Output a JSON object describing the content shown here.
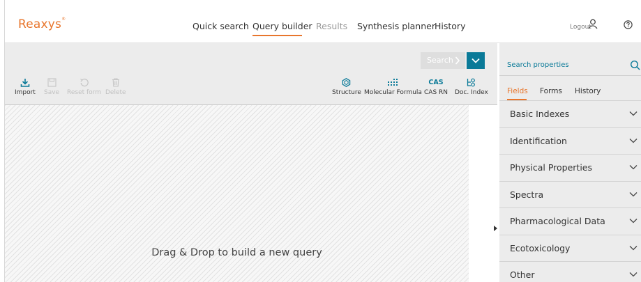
{
  "header": {
    "logo": "Reaxys",
    "logo_mark": "®",
    "nav": [
      {
        "label": "Quick search"
      },
      {
        "label": "Query builder"
      },
      {
        "label": "Results"
      },
      {
        "label": "Synthesis planner"
      },
      {
        "label": "History"
      }
    ],
    "active_nav": "Query builder",
    "logout_label": "Logout"
  },
  "toolbar": {
    "search_label": "Search",
    "left_tools": [
      {
        "label": "Import",
        "icon": "download-icon",
        "enabled": true
      },
      {
        "label": "Save",
        "icon": "save-icon",
        "enabled": false
      },
      {
        "label": "Reset form",
        "icon": "reset-icon",
        "enabled": false
      },
      {
        "label": "Delete",
        "icon": "trash-icon",
        "enabled": false
      }
    ],
    "right_tools": [
      {
        "label": "Structure",
        "icon": "structure-icon"
      },
      {
        "label": "Molecular Formula",
        "icon": "molecular-formula-icon"
      },
      {
        "label": "CAS RN",
        "icon": "cas-icon",
        "icon_text": "CAS"
      },
      {
        "label": "Doc. Index",
        "icon": "doc-index-icon"
      }
    ]
  },
  "canvas": {
    "drop_text": "Drag & Drop to build a new query"
  },
  "panel": {
    "search_placeholder": "Search properties",
    "tabs": [
      {
        "label": "Fields"
      },
      {
        "label": "Forms"
      },
      {
        "label": "History"
      }
    ],
    "active_tab": "Fields",
    "sections": [
      {
        "label": "Basic Indexes"
      },
      {
        "label": "Identification"
      },
      {
        "label": "Physical Properties"
      },
      {
        "label": "Spectra"
      },
      {
        "label": "Pharmacological Data"
      },
      {
        "label": "Ecotoxicology"
      },
      {
        "label": "Other"
      }
    ]
  },
  "colors": {
    "accent": "#e8762d",
    "teal": "#0a7a98",
    "toolbar_bg": "#ececec"
  }
}
